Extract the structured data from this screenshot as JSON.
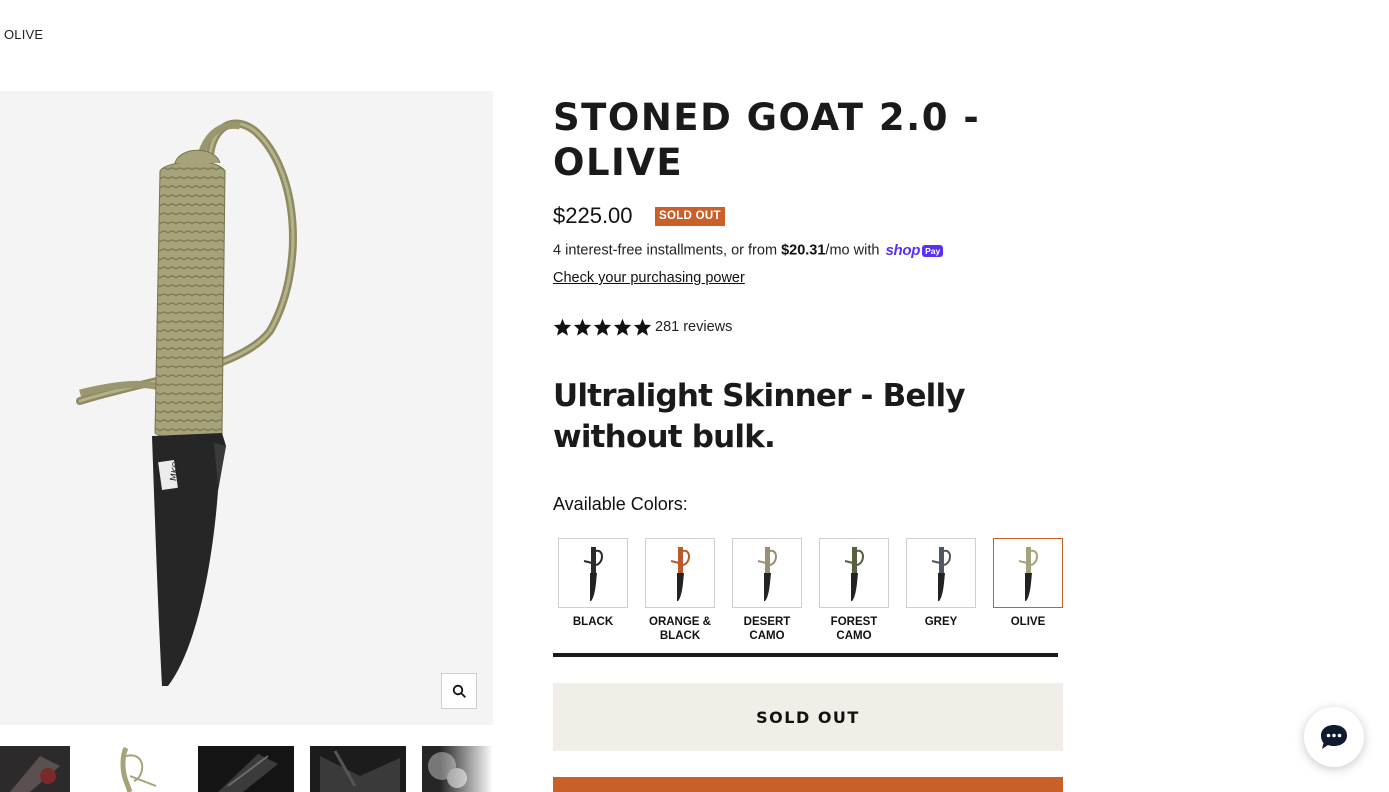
{
  "breadcrumb": {
    "current": "OLIVE"
  },
  "product": {
    "title": "STONED GOAT 2.0 - OLIVE",
    "price": "$225.00",
    "badge": "SOLD OUT",
    "installments": {
      "prefix": "4 interest-free installments, or from ",
      "amount": "$20.31",
      "suffix": "/mo with ",
      "shop": "shop",
      "pay": "Pay"
    },
    "purchasing_power": "Check your purchasing power",
    "rating": {
      "stars": 5,
      "reviews": "281 reviews"
    },
    "subtitle": "Ultralight Skinner - Belly without bulk.",
    "colors_label": "Available Colors:",
    "colors": [
      {
        "label": "BLACK",
        "handle": "#2b2b2b"
      },
      {
        "label": "ORANGE & BLACK",
        "handle": "#b85a2a"
      },
      {
        "label": "DESERT CAMO",
        "handle": "#9a8f72"
      },
      {
        "label": "FOREST CAMO",
        "handle": "#55603f"
      },
      {
        "label": "GREY",
        "handle": "#4f5763"
      },
      {
        "label": "OLIVE",
        "handle": "#a6a37a",
        "selected": true
      }
    ],
    "sold_out_button": "SOLD OUT"
  },
  "colors": {
    "accent": "#c9602a",
    "shop_pay": "#5a31f4",
    "button_bg": "#f1ede7",
    "paracord": "#a6a37a",
    "blade": "#262626"
  },
  "icons": {
    "zoom": "search-icon",
    "chat": "chat-bubble-icon",
    "star": "star-icon"
  }
}
